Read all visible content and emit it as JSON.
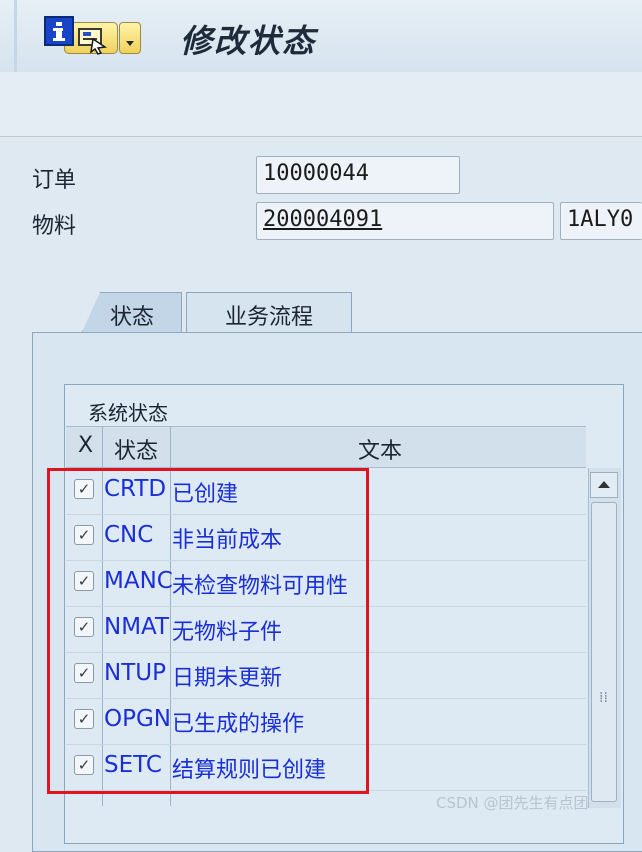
{
  "window": {
    "title": "修改状态"
  },
  "toolbar": {
    "info_icon": "info-icon"
  },
  "header": {
    "order_label": "订单",
    "order_value": "10000044",
    "material_label": "物料",
    "material_value": "200004091",
    "material_desc": "1ALY0"
  },
  "tabs": [
    {
      "label": "状态",
      "active": true
    },
    {
      "label": "业务流程",
      "active": false
    }
  ],
  "system_status": {
    "title": "系统状态",
    "columns": [
      "X",
      "状态",
      "文本"
    ],
    "rows": [
      {
        "checked": true,
        "code": "CRTD",
        "text": "已创建"
      },
      {
        "checked": true,
        "code": "CNC",
        "text": "非当前成本"
      },
      {
        "checked": true,
        "code": "MANC",
        "text": "未检查物料可用性"
      },
      {
        "checked": true,
        "code": "NMAT",
        "text": "无物料子件"
      },
      {
        "checked": true,
        "code": "NTUP",
        "text": "日期未更新"
      },
      {
        "checked": true,
        "code": "OPGN",
        "text": "已生成的操作"
      },
      {
        "checked": true,
        "code": "SETC",
        "text": "结算规则已创建"
      }
    ]
  },
  "check_glyph": "✓",
  "watermark": "CSDN @团先生有点团",
  "colors": {
    "highlight": "#e0141e",
    "status_text": "#1b2fd6"
  }
}
